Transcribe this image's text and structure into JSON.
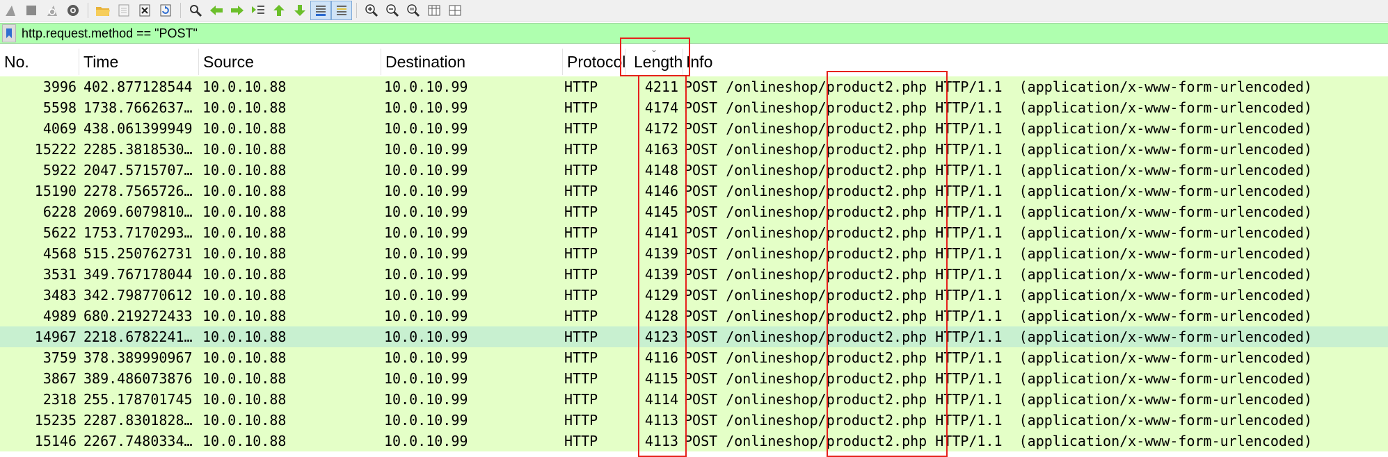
{
  "toolbar": {
    "buttons": [
      {
        "icon": "shark-fin-start-icon"
      },
      {
        "icon": "stop-square-icon"
      },
      {
        "icon": "restart-capture-icon"
      },
      {
        "icon": "capture-options-gear-icon"
      },
      {
        "icon": "open-folder-icon"
      },
      {
        "icon": "save-file-icon"
      },
      {
        "icon": "close-file-icon"
      },
      {
        "icon": "reload-file-icon"
      },
      {
        "icon": "find-packet-icon"
      },
      {
        "icon": "go-back-arrow-icon"
      },
      {
        "icon": "go-forward-arrow-icon"
      },
      {
        "icon": "go-to-packet-icon"
      },
      {
        "icon": "go-to-first-packet-icon"
      },
      {
        "icon": "go-to-last-packet-icon"
      },
      {
        "icon": "autoscroll-icon"
      },
      {
        "icon": "colorize-icon"
      },
      {
        "icon": "zoom-in-icon"
      },
      {
        "icon": "zoom-out-icon"
      },
      {
        "icon": "normal-size-icon"
      },
      {
        "icon": "resize-columns-icon"
      },
      {
        "icon": "layout-icon"
      }
    ]
  },
  "filter": {
    "value": "http.request.method == \"POST\"",
    "background": "#afffaf"
  },
  "columns": {
    "no": "No.",
    "time": "Time",
    "source": "Source",
    "destination": "Destination",
    "protocol": "Protocol",
    "length": "Length",
    "info": "Info"
  },
  "colors": {
    "row_bg": "#e4ffc7",
    "selected_row_bg": "#c8f0d0",
    "annotation": "#e6211b"
  },
  "packets": [
    {
      "no": "3996",
      "time": "402.877128544",
      "source": "10.0.10.88",
      "destination": "10.0.10.99",
      "protocol": "HTTP",
      "length": "4211",
      "info": "POST /onlineshop/product2.php HTTP/1.1  (application/x-www-form-urlencoded)"
    },
    {
      "no": "5598",
      "time": "1738.7662637…",
      "source": "10.0.10.88",
      "destination": "10.0.10.99",
      "protocol": "HTTP",
      "length": "4174",
      "info": "POST /onlineshop/product2.php HTTP/1.1  (application/x-www-form-urlencoded)"
    },
    {
      "no": "4069",
      "time": "438.061399949",
      "source": "10.0.10.88",
      "destination": "10.0.10.99",
      "protocol": "HTTP",
      "length": "4172",
      "info": "POST /onlineshop/product2.php HTTP/1.1  (application/x-www-form-urlencoded)"
    },
    {
      "no": "15222",
      "time": "2285.3818530…",
      "source": "10.0.10.88",
      "destination": "10.0.10.99",
      "protocol": "HTTP",
      "length": "4163",
      "info": "POST /onlineshop/product2.php HTTP/1.1  (application/x-www-form-urlencoded)"
    },
    {
      "no": "5922",
      "time": "2047.5715707…",
      "source": "10.0.10.88",
      "destination": "10.0.10.99",
      "protocol": "HTTP",
      "length": "4148",
      "info": "POST /onlineshop/product2.php HTTP/1.1  (application/x-www-form-urlencoded)"
    },
    {
      "no": "15190",
      "time": "2278.7565726…",
      "source": "10.0.10.88",
      "destination": "10.0.10.99",
      "protocol": "HTTP",
      "length": "4146",
      "info": "POST /onlineshop/product2.php HTTP/1.1  (application/x-www-form-urlencoded)"
    },
    {
      "no": "6228",
      "time": "2069.6079810…",
      "source": "10.0.10.88",
      "destination": "10.0.10.99",
      "protocol": "HTTP",
      "length": "4145",
      "info": "POST /onlineshop/product2.php HTTP/1.1  (application/x-www-form-urlencoded)"
    },
    {
      "no": "5622",
      "time": "1753.7170293…",
      "source": "10.0.10.88",
      "destination": "10.0.10.99",
      "protocol": "HTTP",
      "length": "4141",
      "info": "POST /onlineshop/product2.php HTTP/1.1  (application/x-www-form-urlencoded)"
    },
    {
      "no": "4568",
      "time": "515.250762731",
      "source": "10.0.10.88",
      "destination": "10.0.10.99",
      "protocol": "HTTP",
      "length": "4139",
      "info": "POST /onlineshop/product2.php HTTP/1.1  (application/x-www-form-urlencoded)"
    },
    {
      "no": "3531",
      "time": "349.767178044",
      "source": "10.0.10.88",
      "destination": "10.0.10.99",
      "protocol": "HTTP",
      "length": "4139",
      "info": "POST /onlineshop/product2.php HTTP/1.1  (application/x-www-form-urlencoded)"
    },
    {
      "no": "3483",
      "time": "342.798770612",
      "source": "10.0.10.88",
      "destination": "10.0.10.99",
      "protocol": "HTTP",
      "length": "4129",
      "info": "POST /onlineshop/product2.php HTTP/1.1  (application/x-www-form-urlencoded)"
    },
    {
      "no": "4989",
      "time": "680.219272433",
      "source": "10.0.10.88",
      "destination": "10.0.10.99",
      "protocol": "HTTP",
      "length": "4128",
      "info": "POST /onlineshop/product2.php HTTP/1.1  (application/x-www-form-urlencoded)"
    },
    {
      "no": "14967",
      "time": "2218.6782241…",
      "source": "10.0.10.88",
      "destination": "10.0.10.99",
      "protocol": "HTTP",
      "length": "4123",
      "info": "POST /onlineshop/product2.php HTTP/1.1  (application/x-www-form-urlencoded)",
      "selected": true
    },
    {
      "no": "3759",
      "time": "378.389990967",
      "source": "10.0.10.88",
      "destination": "10.0.10.99",
      "protocol": "HTTP",
      "length": "4116",
      "info": "POST /onlineshop/product2.php HTTP/1.1  (application/x-www-form-urlencoded)"
    },
    {
      "no": "3867",
      "time": "389.486073876",
      "source": "10.0.10.88",
      "destination": "10.0.10.99",
      "protocol": "HTTP",
      "length": "4115",
      "info": "POST /onlineshop/product2.php HTTP/1.1  (application/x-www-form-urlencoded)"
    },
    {
      "no": "2318",
      "time": "255.178701745",
      "source": "10.0.10.88",
      "destination": "10.0.10.99",
      "protocol": "HTTP",
      "length": "4114",
      "info": "POST /onlineshop/product2.php HTTP/1.1  (application/x-www-form-urlencoded)"
    },
    {
      "no": "15235",
      "time": "2287.8301828…",
      "source": "10.0.10.88",
      "destination": "10.0.10.99",
      "protocol": "HTTP",
      "length": "4113",
      "info": "POST /onlineshop/product2.php HTTP/1.1  (application/x-www-form-urlencoded)"
    },
    {
      "no": "15146",
      "time": "2267.7480334…",
      "source": "10.0.10.88",
      "destination": "10.0.10.99",
      "protocol": "HTTP",
      "length": "4113",
      "info": "POST /onlineshop/product2.php HTTP/1.1  (application/x-www-form-urlencoded)"
    }
  ]
}
